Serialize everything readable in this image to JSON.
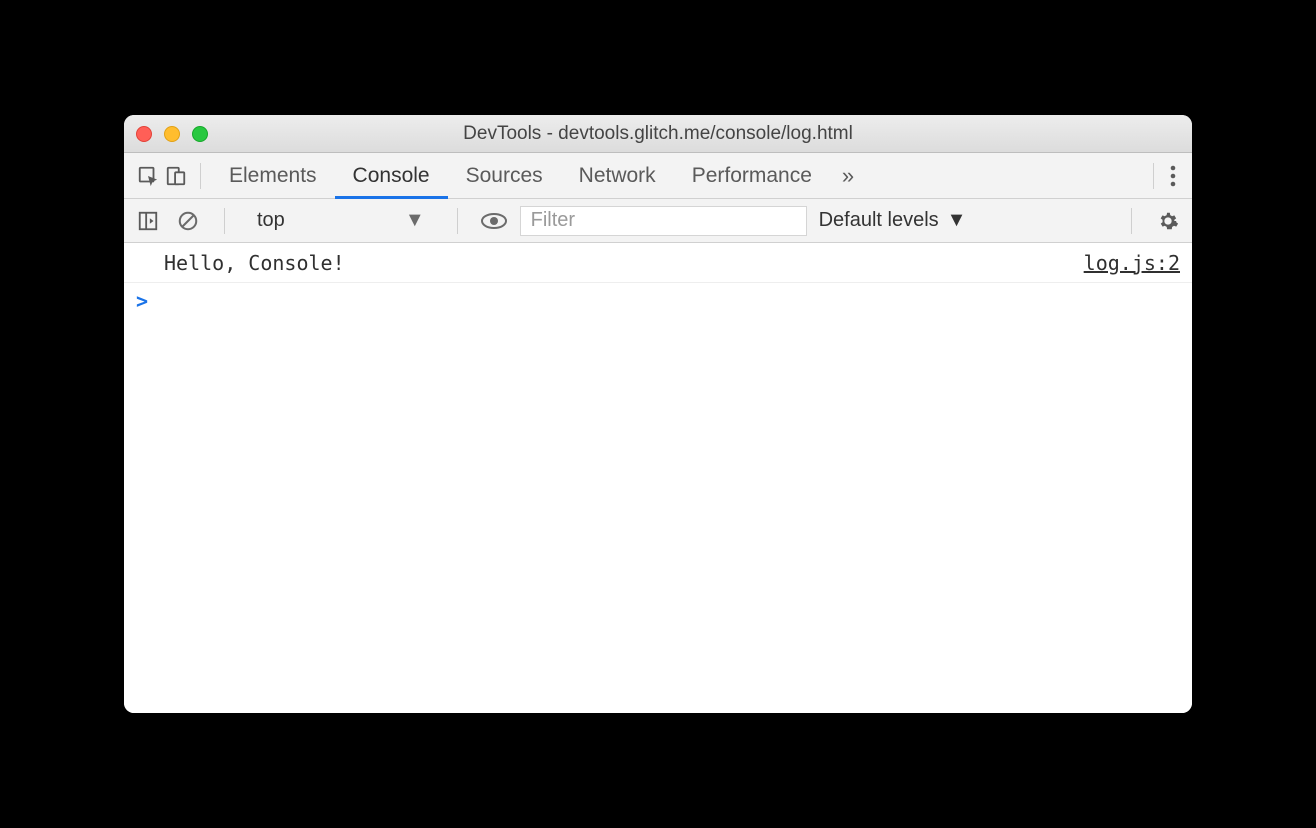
{
  "titlebar": {
    "title": "DevTools - devtools.glitch.me/console/log.html"
  },
  "tabs": {
    "elements": "Elements",
    "console": "Console",
    "sources": "Sources",
    "network": "Network",
    "performance": "Performance"
  },
  "toolbar": {
    "context": "top",
    "filter_placeholder": "Filter",
    "levels": "Default levels"
  },
  "log": {
    "message": "Hello, Console!",
    "source": "log.js:2"
  },
  "prompt": ">"
}
